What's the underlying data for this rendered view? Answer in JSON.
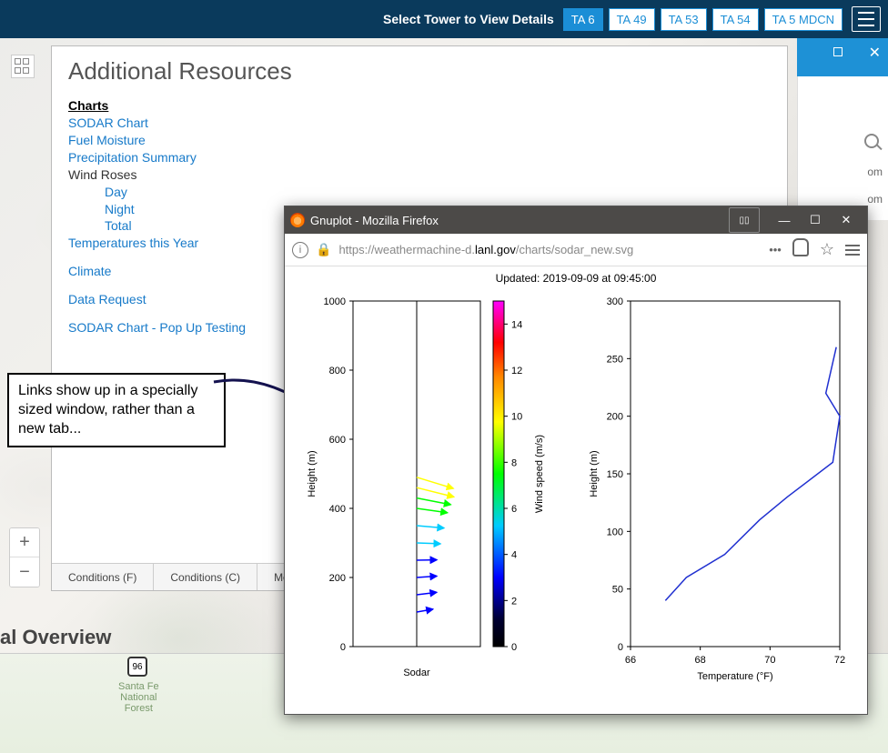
{
  "topbar": {
    "select_label": "Select Tower to View Details",
    "towers": [
      "TA 6",
      "TA 49",
      "TA 53",
      "TA 54",
      "TA 5 MDCN"
    ],
    "active_index": 0
  },
  "panel": {
    "title": "Additional Resources",
    "charts_label": "Charts",
    "wind_roses_label": "Wind Roses",
    "links": {
      "sodar": "SODAR Chart",
      "fuel": "Fuel Moisture",
      "precip": "Precipitation Summary",
      "day": "Day",
      "night": "Night",
      "total": "Total",
      "temps": "Temperatures this Year",
      "climate": "Climate",
      "data_request": "Data Request",
      "sodar_popup": "SODAR Chart - Pop Up Testing"
    }
  },
  "footer": {
    "cond_f": "Conditions (F)",
    "cond_c": "Conditions (C)",
    "more": "More D"
  },
  "overview_label": "al Overview",
  "map_strip": {
    "park_name": "Santa Fe\nNational\nForest",
    "shield": "96"
  },
  "callout": {
    "text": "Links show up in a specially sized window, rather than a new tab..."
  },
  "popup": {
    "title": "Gnuplot - Mozilla Firefox",
    "url_prefix": "https://weathermachine-d.",
    "url_host": "lanl.gov",
    "url_path": "/charts/sodar_new.svg",
    "updated": "Updated: 2019-09-09 at 09:45:00"
  },
  "right_edge": {
    "om1": "om",
    "om2": "om"
  },
  "chart_data": [
    {
      "type": "scatter",
      "title": "Sodar",
      "xlabel": "Sodar",
      "ylabel": "Height (m)",
      "ylim": [
        0,
        1000
      ],
      "yticks": [
        0,
        200,
        400,
        600,
        800,
        1000
      ],
      "colorbar": {
        "label": "Wind speed (m/s)",
        "ticks": [
          0,
          2,
          4,
          6,
          8,
          10,
          12,
          14
        ],
        "range": [
          0,
          15
        ]
      },
      "series": [
        {
          "name": "vectors",
          "heights_m": [
            100,
            150,
            200,
            250,
            300,
            350,
            400,
            430,
            460,
            490
          ],
          "speed_mps": [
            2,
            3,
            3,
            3,
            4,
            5,
            6,
            7,
            8,
            8
          ]
        }
      ]
    },
    {
      "type": "line",
      "title": "",
      "xlabel": "Temperature (°F)",
      "ylabel": "Height (m)",
      "xlim": [
        66,
        72
      ],
      "ylim": [
        0,
        300
      ],
      "xticks": [
        66,
        68,
        70,
        72
      ],
      "yticks": [
        0,
        50,
        100,
        150,
        200,
        250,
        300
      ],
      "series": [
        {
          "name": "temp",
          "x": [
            67.0,
            67.6,
            68.7,
            69.7,
            70.5,
            71.8,
            72.0,
            71.6,
            71.9
          ],
          "y": [
            40,
            60,
            80,
            110,
            130,
            160,
            200,
            220,
            260
          ]
        }
      ]
    }
  ]
}
